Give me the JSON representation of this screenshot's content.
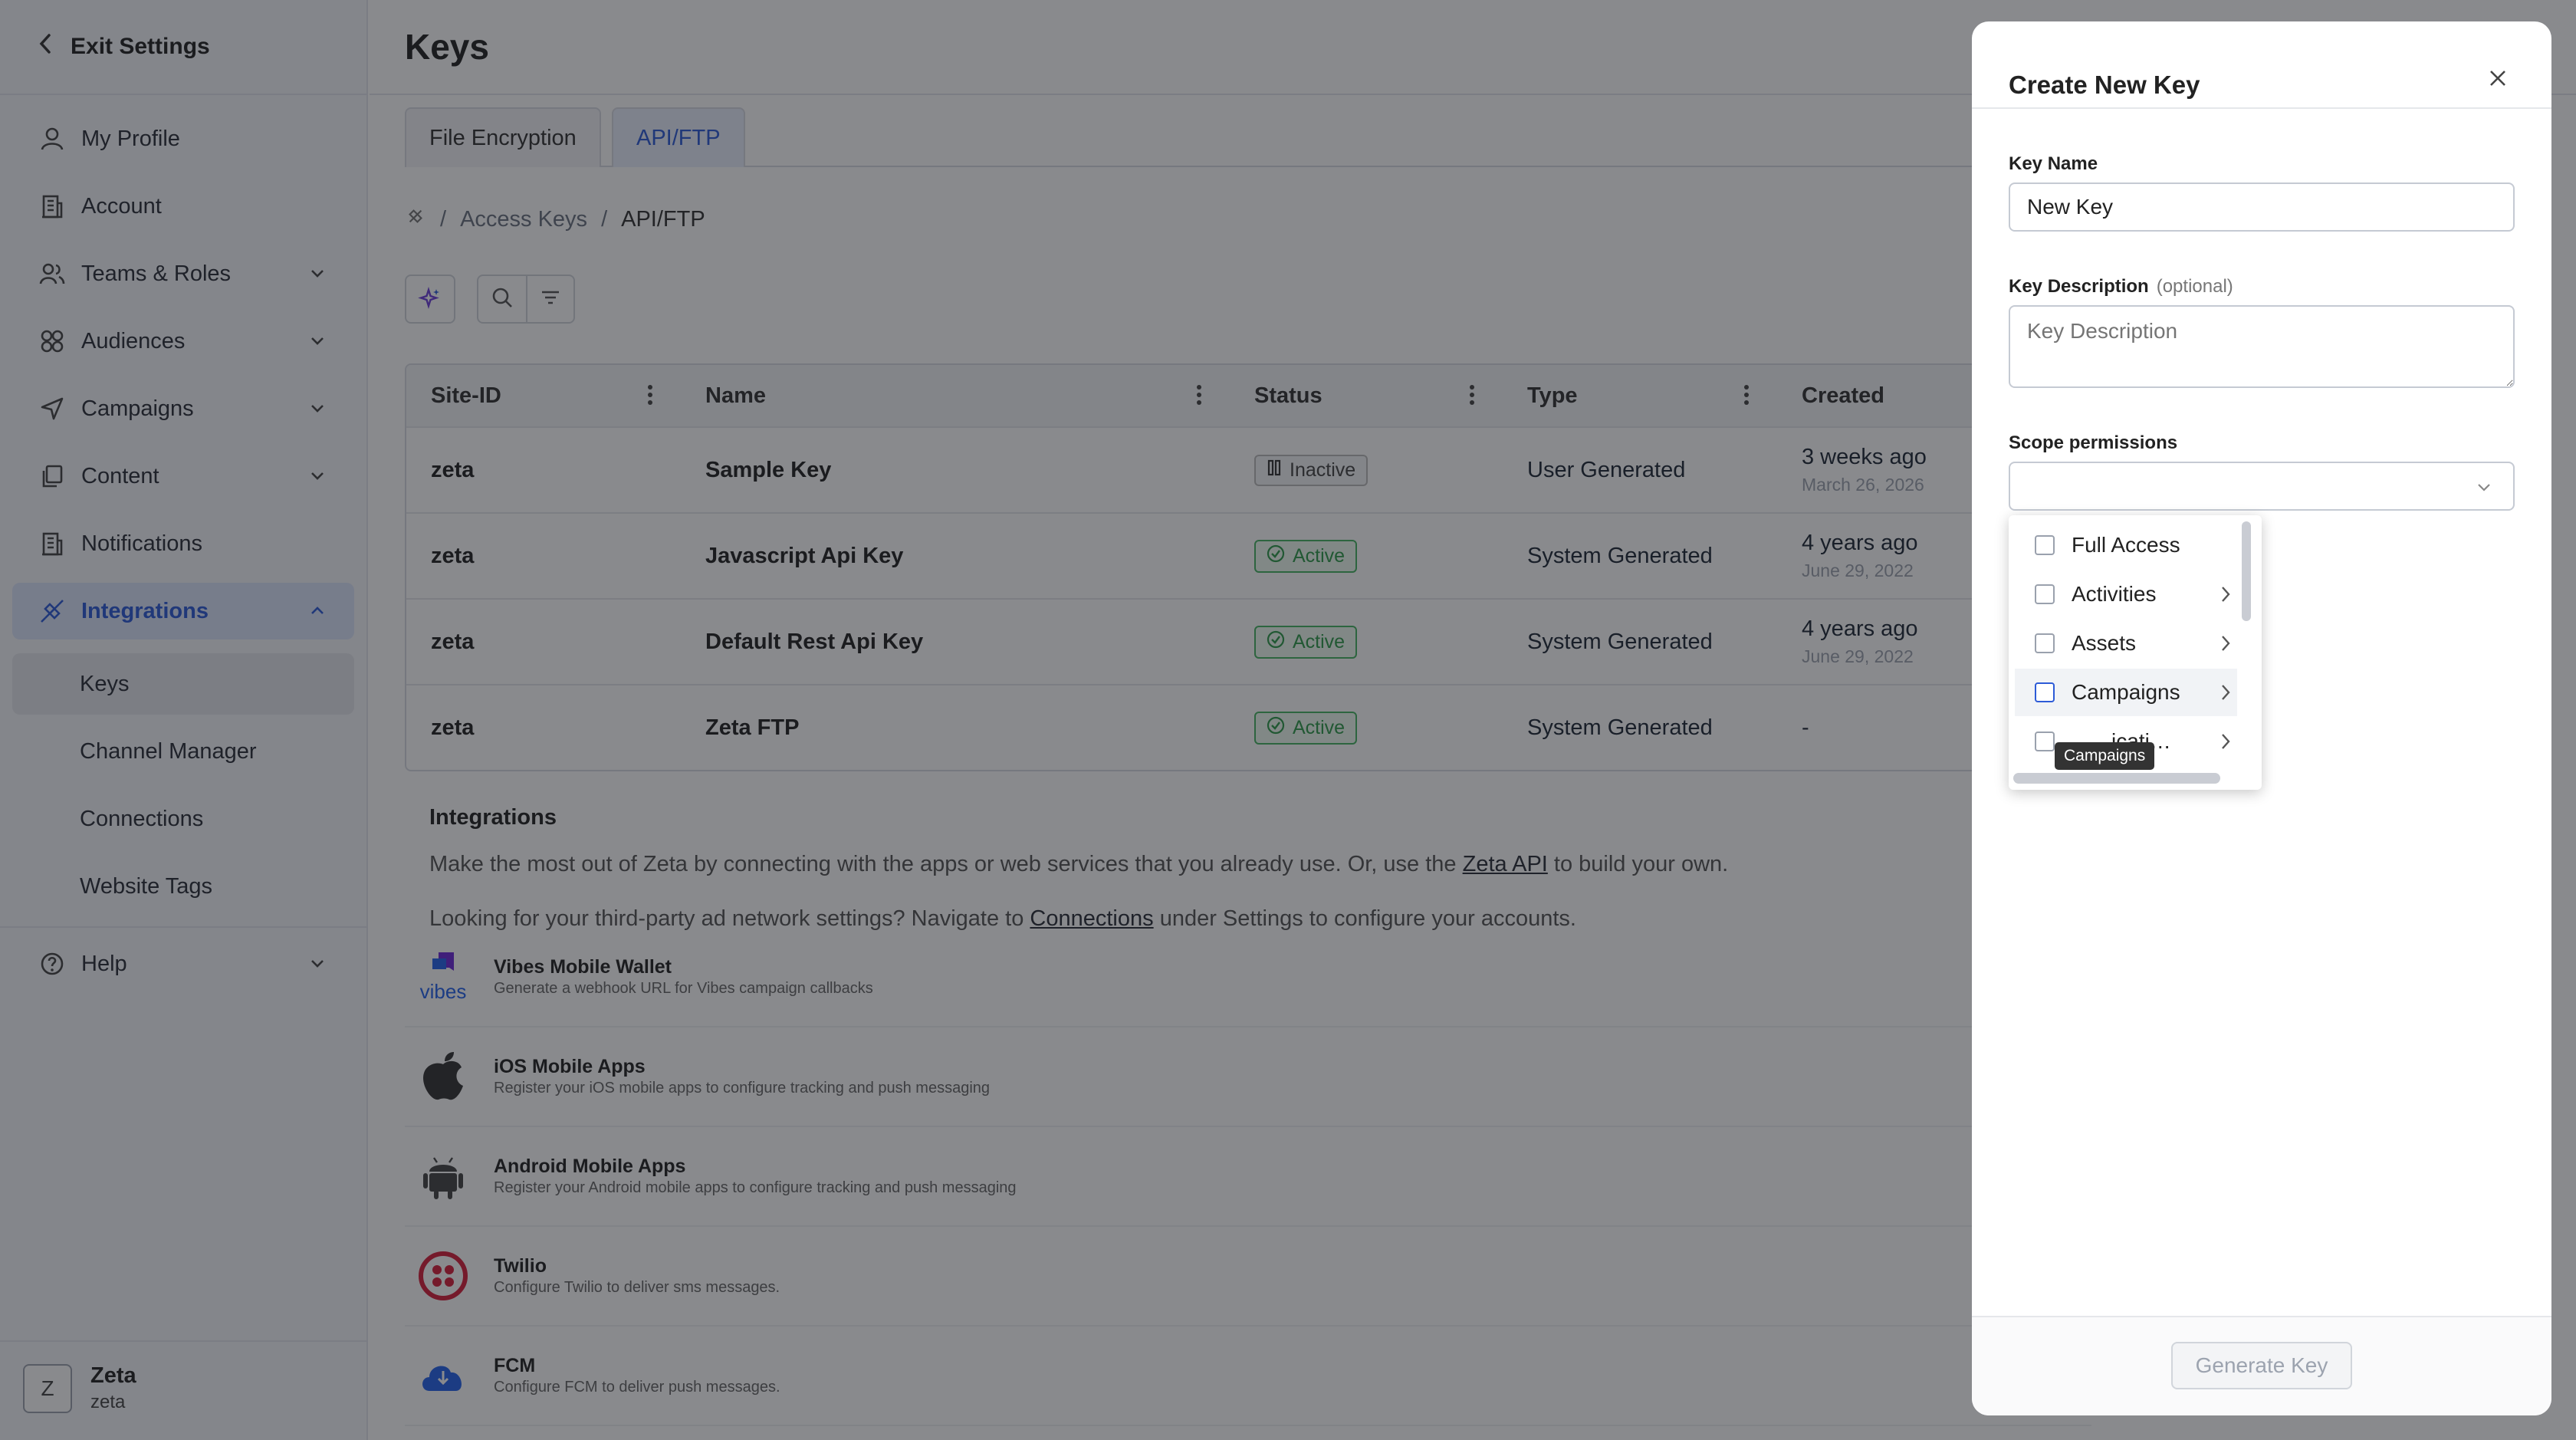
{
  "sidebar": {
    "exit_label": "Exit Settings",
    "items": [
      {
        "label": "My Profile"
      },
      {
        "label": "Account"
      },
      {
        "label": "Teams & Roles"
      },
      {
        "label": "Audiences"
      },
      {
        "label": "Campaigns"
      },
      {
        "label": "Content"
      },
      {
        "label": "Notifications"
      },
      {
        "label": "Integrations"
      },
      {
        "label": "Help"
      }
    ],
    "sub_items": [
      {
        "label": "Keys"
      },
      {
        "label": "Channel Manager"
      },
      {
        "label": "Connections"
      },
      {
        "label": "Website Tags"
      }
    ],
    "user": {
      "initial": "Z",
      "name": "Zeta",
      "site": "zeta"
    }
  },
  "main": {
    "title": "Keys",
    "tabs": [
      {
        "label": "File Encryption"
      },
      {
        "label": "API/FTP"
      }
    ],
    "breadcrumb": [
      "Access Keys",
      "API/FTP"
    ],
    "table": {
      "columns": [
        "Site-ID",
        "Name",
        "Status",
        "Type",
        "Created"
      ],
      "rows": [
        {
          "site": "zeta",
          "name": "Sample Key",
          "status": "Inactive",
          "type": "User Generated",
          "created": "3 weeks ago",
          "created_date": "March 26, 2026"
        },
        {
          "site": "zeta",
          "name": "Javascript Api Key",
          "status": "Active",
          "type": "System Generated",
          "created": "4 years ago",
          "created_date": "June 29, 2022"
        },
        {
          "site": "zeta",
          "name": "Default Rest Api Key",
          "status": "Active",
          "type": "System Generated",
          "created": "4 years ago",
          "created_date": "June 29, 2022"
        },
        {
          "site": "zeta",
          "name": "Zeta FTP",
          "status": "Active",
          "type": "System Generated",
          "created": "-",
          "created_date": ""
        }
      ]
    },
    "integrations": {
      "heading": "Integrations",
      "p1_a": "Make the most out of Zeta by connecting with the apps or web services that you already use. Or, use the ",
      "p1_link": "Zeta API",
      "p1_b": " to build your own.",
      "p2_a": "Looking for your third-party ad network settings? Navigate to ",
      "p2_link": "Connections",
      "p2_b": " under Settings to configure your accounts.",
      "apps": [
        {
          "name": "Vibes Mobile Wallet",
          "desc": "Generate a webhook URL for Vibes campaign callbacks",
          "icon_text": "vibes"
        },
        {
          "name": "iOS Mobile Apps",
          "desc": "Register your iOS mobile apps to configure tracking and push messaging"
        },
        {
          "name": "Android Mobile Apps",
          "desc": "Register your Android mobile apps to configure tracking and push messaging"
        },
        {
          "name": "Twilio",
          "desc": "Configure Twilio to deliver sms messages."
        },
        {
          "name": "FCM",
          "desc": "Configure FCM to deliver push messages."
        }
      ]
    }
  },
  "panel": {
    "title": "Create New Key",
    "key_name_label": "Key Name",
    "key_name_value": "New Key",
    "key_desc_label": "Key Description",
    "key_desc_optional": "(optional)",
    "key_desc_value": "Key Description",
    "scope_label": "Scope permissions",
    "scope_value": "",
    "options": [
      {
        "label": "Full Access",
        "has_children": false
      },
      {
        "label": "Activities",
        "has_children": true
      },
      {
        "label": "Assets",
        "has_children": true
      },
      {
        "label": "Campaigns",
        "has_children": true
      },
      {
        "label": "icati…",
        "has_children": true
      }
    ],
    "tooltip": "Campaigns",
    "generate_label": "Generate Key"
  },
  "colors": {
    "accent": "#2d5bd7",
    "active_green": "#2f9a4a",
    "overlay": "rgba(20,22,28,0.5)"
  }
}
